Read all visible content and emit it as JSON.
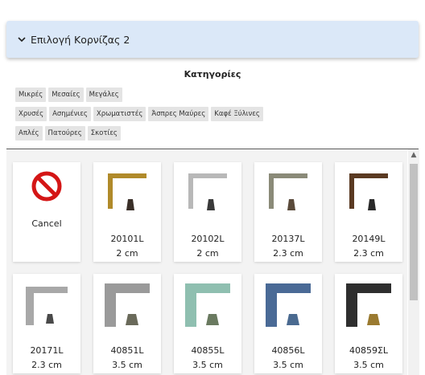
{
  "accordion": {
    "title": "Επιλογή Κορνίζας 2"
  },
  "categories": {
    "title": "Κατηγορίες",
    "rows": [
      [
        "Μικρές",
        "Μεσαίες",
        "Μεγάλες"
      ],
      [
        "Χρυσές",
        "Ασημένιες",
        "Χρωματιστές",
        "Άσπρες Μαύρες",
        "Καφέ Ξύλινες"
      ],
      [
        "Απλές",
        "Πατούρες",
        "Σκοτίες"
      ]
    ]
  },
  "cancel": {
    "label": "Cancel"
  },
  "frames": [
    {
      "code": "20101L",
      "size": "2 cm",
      "color": "#b08a2a"
    },
    {
      "code": "20102L",
      "size": "2 cm",
      "color": "#b8b8b8"
    },
    {
      "code": "20137L",
      "size": "2.3 cm",
      "color": "#8a8a78"
    },
    {
      "code": "20149L",
      "size": "2.3 cm",
      "color": "#5a3a22"
    },
    {
      "code": "20171L",
      "size": "2.3 cm",
      "color": "#a8a8a8"
    },
    {
      "code": "40851L",
      "size": "3.5 cm",
      "color": "#9a9a9a"
    },
    {
      "code": "40855L",
      "size": "3.5 cm",
      "color": "#8fbfb0"
    },
    {
      "code": "40856L",
      "size": "3.5 cm",
      "color": "#4a6a96"
    },
    {
      "code": "40859ΣL",
      "size": "3.5 cm",
      "color": "#2e2e2e"
    }
  ]
}
